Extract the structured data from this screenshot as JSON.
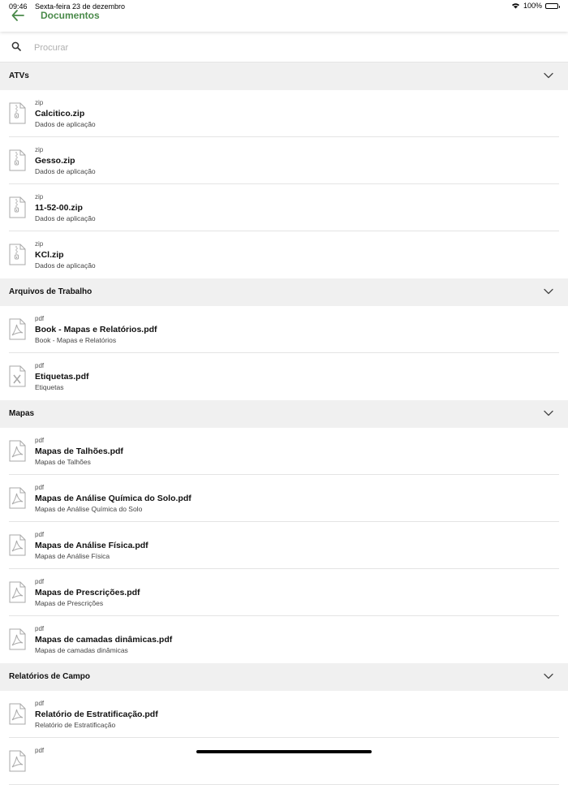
{
  "status_bar": {
    "time": "09:46",
    "date": "Sexta-feira 23 de dezembro",
    "battery": "100%"
  },
  "header": {
    "title": "Documentos",
    "accent_color": "#4a8a4a"
  },
  "search": {
    "placeholder": "Procurar",
    "value": ""
  },
  "sections": [
    {
      "title": "ATVs",
      "items": [
        {
          "type": "zip",
          "name": "Calcitico.zip",
          "description": "Dados de aplicação",
          "icon": "zip-file-icon"
        },
        {
          "type": "zip",
          "name": "Gesso.zip",
          "description": "Dados de aplicação",
          "icon": "zip-file-icon"
        },
        {
          "type": "zip",
          "name": "11-52-00.zip",
          "description": "Dados de aplicação",
          "icon": "zip-file-icon"
        },
        {
          "type": "zip",
          "name": "KCl.zip",
          "description": "Dados de aplicação",
          "icon": "zip-file-icon"
        }
      ]
    },
    {
      "title": "Arquivos de Trabalho",
      "items": [
        {
          "type": "pdf",
          "name": "Book - Mapas e Relatórios.pdf",
          "description": "Book - Mapas e Relatórios",
          "icon": "pdf-file-icon"
        },
        {
          "type": "pdf",
          "name": "Etiquetas.pdf",
          "description": "Etiquetas",
          "icon": "excel-file-icon"
        }
      ]
    },
    {
      "title": "Mapas",
      "items": [
        {
          "type": "pdf",
          "name": "Mapas de Talhões.pdf",
          "description": "Mapas de Talhões",
          "icon": "pdf-file-icon"
        },
        {
          "type": "pdf",
          "name": "Mapas de Análise Química do Solo.pdf",
          "description": "Mapas de Análise Química do Solo",
          "icon": "pdf-file-icon"
        },
        {
          "type": "pdf",
          "name": "Mapas de Análise Física.pdf",
          "description": "Mapas de Análise Física",
          "icon": "pdf-file-icon"
        },
        {
          "type": "pdf",
          "name": "Mapas de Prescrições.pdf",
          "description": "Mapas de Prescrições",
          "icon": "pdf-file-icon"
        },
        {
          "type": "pdf",
          "name": "Mapas de camadas dinâmicas.pdf",
          "description": "Mapas de camadas dinâmicas",
          "icon": "pdf-file-icon"
        }
      ]
    },
    {
      "title": "Relatórios de Campo",
      "items": [
        {
          "type": "pdf",
          "name": "Relatório de Estratificação.pdf",
          "description": "Relatório de Estratificação",
          "icon": "pdf-file-icon"
        },
        {
          "type": "pdf",
          "name": "",
          "description": "",
          "icon": "pdf-file-icon"
        }
      ]
    }
  ]
}
